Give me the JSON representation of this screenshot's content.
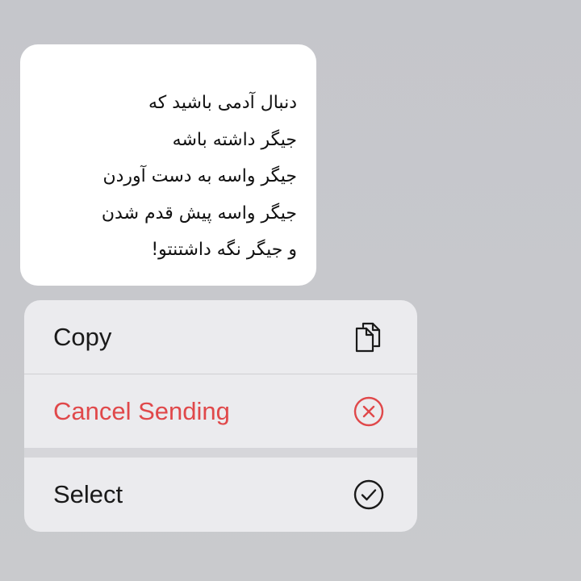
{
  "message": {
    "lines": [
      "دنبال آدمی باشید که",
      "جیگر داشته باشه",
      "جیگر واسه به دست آوردن",
      "جیگر واسه پیش قدم شدن",
      "و جیگر نگه داشتنتو!"
    ]
  },
  "context_menu": {
    "items": [
      {
        "label": "Copy",
        "icon": "copy-icon",
        "color": "#1a1a1a"
      },
      {
        "label": "Cancel Sending",
        "icon": "x-circle-icon",
        "color": "#e0484a"
      },
      {
        "label": "Select",
        "icon": "check-circle-icon",
        "color": "#1a1a1a"
      }
    ]
  },
  "colors": {
    "background": "#c7c8cc",
    "bubble": "#ffffff",
    "menu": "#ebebee",
    "destructive": "#e0484a"
  }
}
